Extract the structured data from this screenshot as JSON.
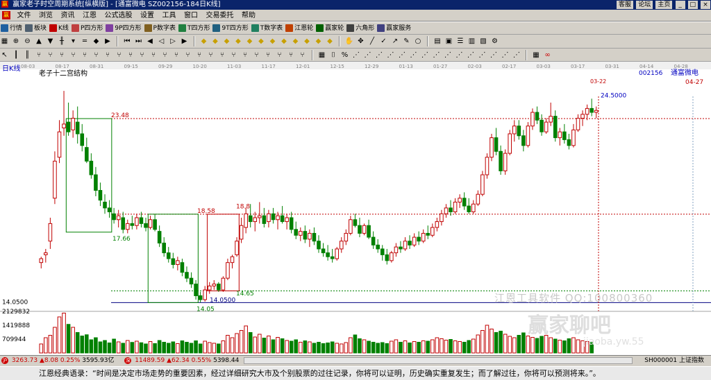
{
  "window": {
    "title": "赢家老子时空周期系统[纵横版] - [通富微电   SZ002156-184日K线]",
    "links": [
      "客服",
      "论坛",
      "主页"
    ],
    "window_buttons": [
      "_",
      "□",
      "×"
    ],
    "logo_text": "赢"
  },
  "menu": [
    "文件",
    "浏览",
    "资讯",
    "江恩",
    "公式选股",
    "设置",
    "工具",
    "窗口",
    "交易委托",
    "帮助"
  ],
  "toolbar1": [
    {
      "label": "行情",
      "icon": "chart-icon",
      "color": "#2060a0"
    },
    {
      "label": "板块",
      "icon": "grid-icon",
      "color": "#506070"
    },
    {
      "label": "K线",
      "icon": "kline-icon",
      "color": "#c00000"
    },
    {
      "label": "P四方形",
      "icon": "square-icon",
      "color": "#c04040"
    },
    {
      "label": "9P四方形",
      "icon": "square-icon",
      "color": "#8040a0"
    },
    {
      "label": "P数字表",
      "icon": "table-icon",
      "color": "#806020"
    },
    {
      "label": "T四方形",
      "icon": "square-icon",
      "color": "#208040"
    },
    {
      "label": "9T四方形",
      "icon": "square-icon",
      "color": "#206080"
    },
    {
      "label": "T数字表",
      "icon": "table-icon",
      "color": "#208060"
    },
    {
      "label": "江恩轮",
      "icon": "wheel-icon",
      "color": "#c04000"
    },
    {
      "label": "赢家轮",
      "icon": "wheel-icon",
      "color": "#006000"
    },
    {
      "label": "六角形",
      "icon": "hexagon-icon",
      "color": "#404040"
    },
    {
      "label": "赢家服务",
      "icon": "service-icon",
      "color": "#404080"
    }
  ],
  "top_date_axis": [
    "08-03",
    "08-17",
    "08-31",
    "09-15",
    "09-29",
    "10-20",
    "11-03",
    "11-17",
    "12-01",
    "12-15",
    "12-29",
    "01-13",
    "01-27",
    "02-03",
    "02-17",
    "03-03",
    "03-17",
    "03-31",
    "04-14",
    "04-28"
  ],
  "panel": {
    "timeframe": "日K线",
    "indicator_title": "老子十二宫结构",
    "stock_code": "002156",
    "stock_name": "通富微电",
    "right_date": "04-27",
    "top_marker_date": "03-22"
  },
  "watermark": {
    "line1": "江恩工具软件  QQ:100800360",
    "line2": "赢家聊吧",
    "line3": "jiaoba.yw.55"
  },
  "chart_data": {
    "type": "candlestick",
    "title": "老子十二宫结构",
    "price_labels": [
      "23.48",
      "17.66",
      "18.58",
      "18.8",
      "14.65",
      "14.05",
      "14.0500",
      "24.5000"
    ],
    "left_axis_price_label": "14.0500",
    "volume_axis_labels": [
      "2129832",
      "1419888",
      "709944"
    ],
    "candles": [
      {
        "o": 16.1,
        "h": 16.4,
        "l": 15.8,
        "c": 16.3
      },
      {
        "o": 16.5,
        "h": 16.8,
        "l": 16.1,
        "c": 16.6
      },
      {
        "o": 17.2,
        "h": 18.4,
        "l": 16.8,
        "c": 18.1
      },
      {
        "o": 19.4,
        "h": 21.8,
        "l": 19.1,
        "c": 21.3
      },
      {
        "o": 21.5,
        "h": 23.4,
        "l": 21.2,
        "c": 22.8
      },
      {
        "o": 23.0,
        "h": 24.9,
        "l": 22.6,
        "c": 23.2
      },
      {
        "o": 23.3,
        "h": 24.3,
        "l": 22.6,
        "c": 22.8
      },
      {
        "o": 22.9,
        "h": 23.9,
        "l": 22.5,
        "c": 23.5
      },
      {
        "o": 23.3,
        "h": 24.1,
        "l": 22.2,
        "c": 22.7
      },
      {
        "o": 22.7,
        "h": 23.2,
        "l": 21.8,
        "c": 22.1
      },
      {
        "o": 22.0,
        "h": 22.5,
        "l": 21.2,
        "c": 21.3
      },
      {
        "o": 21.3,
        "h": 21.7,
        "l": 20.4,
        "c": 20.6
      },
      {
        "o": 20.6,
        "h": 21.0,
        "l": 19.5,
        "c": 19.8
      },
      {
        "o": 19.8,
        "h": 20.2,
        "l": 19.0,
        "c": 19.3
      },
      {
        "o": 19.2,
        "h": 19.6,
        "l": 18.6,
        "c": 18.9
      },
      {
        "o": 18.9,
        "h": 19.3,
        "l": 18.4,
        "c": 18.7
      },
      {
        "o": 18.6,
        "h": 18.9,
        "l": 18.1,
        "c": 18.3
      },
      {
        "o": 18.3,
        "h": 18.8,
        "l": 17.9,
        "c": 18.5
      },
      {
        "o": 18.4,
        "h": 18.7,
        "l": 17.6,
        "c": 17.8
      },
      {
        "o": 17.8,
        "h": 18.3,
        "l": 17.6,
        "c": 18.1
      },
      {
        "o": 18.1,
        "h": 18.5,
        "l": 17.8,
        "c": 18.0
      },
      {
        "o": 18.0,
        "h": 18.6,
        "l": 17.8,
        "c": 18.4
      },
      {
        "o": 18.4,
        "h": 18.7,
        "l": 17.9,
        "c": 18.1
      },
      {
        "o": 18.1,
        "h": 18.4,
        "l": 17.7,
        "c": 17.9
      },
      {
        "o": 17.9,
        "h": 18.5,
        "l": 17.8,
        "c": 18.3
      },
      {
        "o": 18.3,
        "h": 18.6,
        "l": 17.7,
        "c": 17.8
      },
      {
        "o": 17.7,
        "h": 18.0,
        "l": 16.9,
        "c": 17.1
      },
      {
        "o": 17.1,
        "h": 17.4,
        "l": 16.4,
        "c": 16.6
      },
      {
        "o": 16.6,
        "h": 16.9,
        "l": 16.1,
        "c": 16.3
      },
      {
        "o": 16.3,
        "h": 16.6,
        "l": 15.8,
        "c": 16.0
      },
      {
        "o": 16.0,
        "h": 16.4,
        "l": 15.7,
        "c": 16.2
      },
      {
        "o": 16.1,
        "h": 16.3,
        "l": 15.4,
        "c": 15.6
      },
      {
        "o": 15.6,
        "h": 15.9,
        "l": 15.1,
        "c": 15.3
      },
      {
        "o": 15.3,
        "h": 15.6,
        "l": 14.8,
        "c": 15.0
      },
      {
        "o": 15.0,
        "h": 15.2,
        "l": 14.2,
        "c": 14.4
      },
      {
        "o": 14.4,
        "h": 14.6,
        "l": 14.05,
        "c": 14.2
      },
      {
        "o": 14.2,
        "h": 14.9,
        "l": 14.1,
        "c": 14.7
      },
      {
        "o": 14.7,
        "h": 15.1,
        "l": 14.5,
        "c": 14.9
      },
      {
        "o": 14.9,
        "h": 15.2,
        "l": 14.7,
        "c": 15.0
      },
      {
        "o": 15.0,
        "h": 15.1,
        "l": 14.6,
        "c": 14.7
      },
      {
        "o": 14.7,
        "h": 15.4,
        "l": 14.6,
        "c": 15.3
      },
      {
        "o": 15.3,
        "h": 16.3,
        "l": 15.2,
        "c": 16.1
      },
      {
        "o": 16.1,
        "h": 16.5,
        "l": 15.8,
        "c": 16.4
      },
      {
        "o": 16.5,
        "h": 17.4,
        "l": 16.4,
        "c": 17.2
      },
      {
        "o": 17.3,
        "h": 18.4,
        "l": 17.1,
        "c": 18.0
      },
      {
        "o": 17.9,
        "h": 18.9,
        "l": 17.6,
        "c": 18.6
      },
      {
        "o": 18.5,
        "h": 19.1,
        "l": 17.9,
        "c": 18.2
      },
      {
        "o": 18.2,
        "h": 18.7,
        "l": 17.7,
        "c": 18.4
      },
      {
        "o": 18.4,
        "h": 19.2,
        "l": 18.1,
        "c": 18.5
      },
      {
        "o": 18.5,
        "h": 18.9,
        "l": 17.9,
        "c": 18.1
      },
      {
        "o": 18.2,
        "h": 18.8,
        "l": 17.9,
        "c": 18.6
      },
      {
        "o": 18.6,
        "h": 18.9,
        "l": 18.1,
        "c": 18.3
      },
      {
        "o": 18.3,
        "h": 18.7,
        "l": 17.8,
        "c": 18.5
      },
      {
        "o": 18.5,
        "h": 19.0,
        "l": 18.1,
        "c": 18.2
      },
      {
        "o": 18.2,
        "h": 18.6,
        "l": 17.8,
        "c": 18.4
      },
      {
        "o": 18.4,
        "h": 18.7,
        "l": 17.6,
        "c": 17.8
      },
      {
        "o": 17.8,
        "h": 18.2,
        "l": 17.3,
        "c": 17.5
      },
      {
        "o": 17.5,
        "h": 17.9,
        "l": 17.2,
        "c": 17.7
      },
      {
        "o": 17.7,
        "h": 18.0,
        "l": 17.1,
        "c": 17.3
      },
      {
        "o": 17.3,
        "h": 17.8,
        "l": 16.9,
        "c": 17.6
      },
      {
        "o": 17.6,
        "h": 17.9,
        "l": 17.0,
        "c": 17.2
      },
      {
        "o": 17.2,
        "h": 17.5,
        "l": 16.6,
        "c": 16.8
      },
      {
        "o": 16.8,
        "h": 17.1,
        "l": 16.4,
        "c": 16.6
      },
      {
        "o": 16.6,
        "h": 17.0,
        "l": 16.2,
        "c": 16.4
      },
      {
        "o": 16.4,
        "h": 16.8,
        "l": 16.1,
        "c": 16.3
      },
      {
        "o": 16.3,
        "h": 16.9,
        "l": 16.2,
        "c": 16.8
      },
      {
        "o": 16.8,
        "h": 17.4,
        "l": 16.6,
        "c": 17.2
      },
      {
        "o": 17.2,
        "h": 17.8,
        "l": 17.0,
        "c": 17.6
      },
      {
        "o": 17.6,
        "h": 18.5,
        "l": 17.5,
        "c": 18.3
      },
      {
        "o": 18.3,
        "h": 18.6,
        "l": 17.9,
        "c": 18.0
      },
      {
        "o": 18.0,
        "h": 18.4,
        "l": 17.4,
        "c": 17.6
      },
      {
        "o": 17.6,
        "h": 18.1,
        "l": 17.5,
        "c": 18.0
      },
      {
        "o": 18.0,
        "h": 18.3,
        "l": 17.3,
        "c": 17.4
      },
      {
        "o": 17.4,
        "h": 17.7,
        "l": 16.8,
        "c": 17.0
      },
      {
        "o": 17.0,
        "h": 17.3,
        "l": 16.6,
        "c": 16.8
      },
      {
        "o": 16.8,
        "h": 17.0,
        "l": 16.2,
        "c": 16.5
      },
      {
        "o": 16.5,
        "h": 16.8,
        "l": 16.0,
        "c": 16.2
      },
      {
        "o": 16.2,
        "h": 16.7,
        "l": 16.1,
        "c": 16.6
      },
      {
        "o": 16.6,
        "h": 17.1,
        "l": 16.4,
        "c": 16.9
      },
      {
        "o": 16.9,
        "h": 17.2,
        "l": 16.6,
        "c": 16.8
      },
      {
        "o": 16.8,
        "h": 17.4,
        "l": 16.7,
        "c": 17.2
      },
      {
        "o": 17.2,
        "h": 17.5,
        "l": 16.8,
        "c": 17.0
      },
      {
        "o": 17.0,
        "h": 17.6,
        "l": 16.9,
        "c": 17.4
      },
      {
        "o": 17.4,
        "h": 17.7,
        "l": 17.0,
        "c": 17.2
      },
      {
        "o": 17.2,
        "h": 17.8,
        "l": 17.1,
        "c": 17.6
      },
      {
        "o": 17.6,
        "h": 18.0,
        "l": 17.3,
        "c": 17.5
      },
      {
        "o": 17.5,
        "h": 18.1,
        "l": 17.4,
        "c": 17.9
      },
      {
        "o": 17.9,
        "h": 18.4,
        "l": 17.7,
        "c": 18.2
      },
      {
        "o": 18.2,
        "h": 18.8,
        "l": 18.0,
        "c": 18.6
      },
      {
        "o": 18.6,
        "h": 19.1,
        "l": 18.4,
        "c": 18.9
      },
      {
        "o": 18.9,
        "h": 19.3,
        "l": 18.5,
        "c": 18.7
      },
      {
        "o": 18.7,
        "h": 19.4,
        "l": 18.6,
        "c": 19.2
      },
      {
        "o": 19.2,
        "h": 19.6,
        "l": 18.9,
        "c": 19.4
      },
      {
        "o": 19.4,
        "h": 19.7,
        "l": 18.8,
        "c": 19.0
      },
      {
        "o": 19.0,
        "h": 19.4,
        "l": 18.6,
        "c": 18.7
      },
      {
        "o": 18.7,
        "h": 19.3,
        "l": 18.6,
        "c": 19.1
      },
      {
        "o": 19.1,
        "h": 19.8,
        "l": 19.0,
        "c": 19.6
      },
      {
        "o": 19.6,
        "h": 20.8,
        "l": 19.5,
        "c": 20.6
      },
      {
        "o": 20.6,
        "h": 21.7,
        "l": 20.4,
        "c": 21.5
      },
      {
        "o": 21.5,
        "h": 22.7,
        "l": 21.3,
        "c": 22.5
      },
      {
        "o": 22.5,
        "h": 23.0,
        "l": 21.6,
        "c": 21.8
      },
      {
        "o": 21.8,
        "h": 22.1,
        "l": 20.6,
        "c": 20.8
      },
      {
        "o": 20.8,
        "h": 21.9,
        "l": 20.6,
        "c": 21.7
      },
      {
        "o": 21.7,
        "h": 22.9,
        "l": 21.6,
        "c": 22.7
      },
      {
        "o": 22.7,
        "h": 23.4,
        "l": 22.3,
        "c": 23.1
      },
      {
        "o": 23.1,
        "h": 23.4,
        "l": 22.4,
        "c": 22.6
      },
      {
        "o": 22.6,
        "h": 22.9,
        "l": 21.8,
        "c": 22.1
      },
      {
        "o": 22.1,
        "h": 23.3,
        "l": 22.0,
        "c": 23.1
      },
      {
        "o": 23.1,
        "h": 24.0,
        "l": 22.9,
        "c": 23.8
      },
      {
        "o": 23.8,
        "h": 24.1,
        "l": 23.2,
        "c": 23.4
      },
      {
        "o": 23.4,
        "h": 23.7,
        "l": 22.6,
        "c": 22.8
      },
      {
        "o": 22.8,
        "h": 23.5,
        "l": 22.7,
        "c": 23.3
      },
      {
        "o": 23.3,
        "h": 24.3,
        "l": 23.1,
        "c": 23.6
      },
      {
        "o": 23.6,
        "h": 23.9,
        "l": 22.3,
        "c": 22.5
      },
      {
        "o": 22.5,
        "h": 23.0,
        "l": 22.1,
        "c": 22.8
      },
      {
        "o": 22.8,
        "h": 23.2,
        "l": 22.2,
        "c": 22.4
      },
      {
        "o": 22.4,
        "h": 22.7,
        "l": 21.9,
        "c": 22.1
      },
      {
        "o": 22.1,
        "h": 23.2,
        "l": 22.0,
        "c": 22.9
      },
      {
        "o": 22.9,
        "h": 23.7,
        "l": 22.8,
        "c": 23.5
      },
      {
        "o": 23.5,
        "h": 23.9,
        "l": 23.1,
        "c": 23.7
      },
      {
        "o": 23.7,
        "h": 24.2,
        "l": 23.4,
        "c": 24.0
      },
      {
        "o": 24.0,
        "h": 24.5,
        "l": 23.6,
        "c": 23.8
      },
      {
        "o": 23.8,
        "h": 24.1,
        "l": 23.5,
        "c": 23.9
      }
    ],
    "volumes": [
      520,
      880,
      1020,
      1480,
      2080,
      2300,
      1650,
      1480,
      1180,
      980,
      1050,
      760,
      880,
      640,
      720,
      580,
      800,
      640,
      560,
      720,
      610,
      680,
      590,
      520,
      660,
      540,
      720,
      620,
      560,
      640,
      540,
      700,
      620,
      560,
      700,
      520,
      680,
      600,
      560,
      520,
      700,
      1020,
      880,
      1120,
      1300,
      1560,
      1180,
      920,
      1080,
      860,
      980,
      760,
      900,
      820,
      720,
      680,
      760,
      620,
      700,
      640,
      560,
      620,
      540,
      580,
      640,
      560,
      520,
      600,
      880,
      1040,
      820,
      760,
      680,
      620,
      560,
      600,
      540,
      680,
      760,
      620,
      700,
      580,
      660,
      620,
      700,
      680,
      760,
      880,
      820,
      740,
      780,
      700,
      660,
      620,
      720,
      800,
      1040,
      1300,
      1600,
      1380,
      1180,
      1260,
      1080,
      960,
      880,
      1020,
      1160,
      980,
      900,
      840,
      960,
      1020,
      880,
      800,
      740,
      700,
      820,
      880,
      760,
      700,
      660,
      600
    ],
    "y_range": [
      13.6,
      25.4
    ],
    "volume_range": [
      0,
      2400
    ],
    "reference_lines": [
      {
        "price": 23.48,
        "color": "#c00000",
        "style": "dashed"
      },
      {
        "price": 18.58,
        "color": "#c00000",
        "style": "dashed"
      },
      {
        "price": 14.65,
        "color": "#008000",
        "style": "dashed"
      },
      {
        "price": 14.05,
        "color": "#000080",
        "style": "solid"
      }
    ],
    "boxes": [
      {
        "from_index": 6,
        "to_index": 15,
        "high": 23.48,
        "low": 17.66,
        "color": "#008000"
      },
      {
        "from_index": 24,
        "to_index": 34,
        "high": 18.58,
        "low": 14.05,
        "color": "#008000"
      },
      {
        "from_index": 37,
        "to_index": 43,
        "high": 18.58,
        "low": 14.65,
        "color": "#c00000"
      }
    ]
  },
  "statusbar": {
    "idx1_value": "3263.73",
    "idx1_change": "▲8.08",
    "idx1_pct": "0.25%",
    "idx1_amount": "3595.93亿",
    "idx2_value": "11489.59",
    "idx2_change": "▲62.34",
    "idx2_pct": "0.55%",
    "idx2_amount": "5398.44",
    "right_index": "SH000001 上证指数"
  },
  "quote": "江恩经典语录：“时间是决定市场走势的重要因素，经过详细研究大市及个别股票的过往记录，你将可以证明，历史确实重复发生；而了解过往，你将可以预测将来。”。"
}
